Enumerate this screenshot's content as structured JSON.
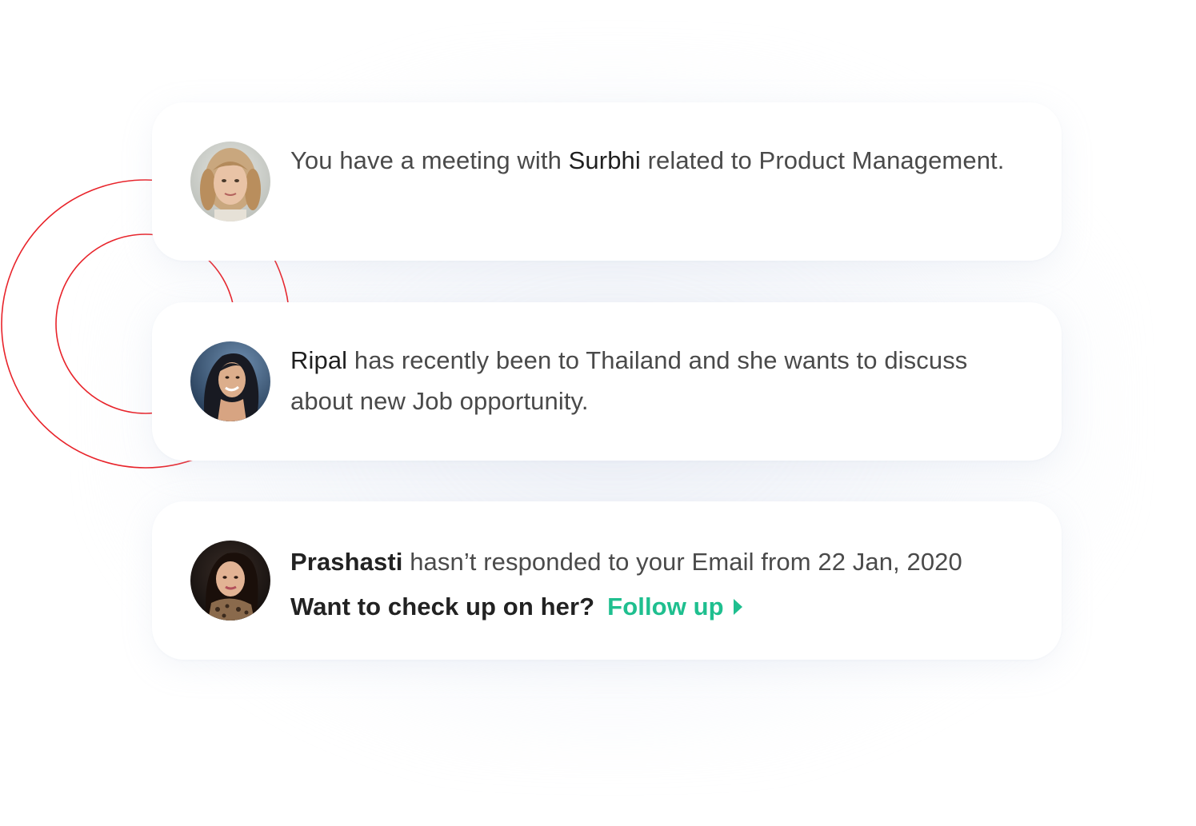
{
  "notifications": [
    {
      "prefix": "You have a meeting with ",
      "name": "Surbhi",
      "suffix": " related to Product Management.",
      "avatar_icon": "person-photo-avatar"
    },
    {
      "prefix": "",
      "name": "Ripal",
      "suffix": " has recently been to Thailand and she wants to discuss about new Job opportunity.",
      "avatar_icon": "person-photo-avatar"
    },
    {
      "prefix": "",
      "name": "Prashasti",
      "suffix": " hasn’t responded to your Email from 22 Jan, 2020",
      "question": "Want to check up on her?",
      "action_label": "Follow up",
      "action_icon": "caret-right-icon",
      "avatar_icon": "person-photo-avatar"
    }
  ],
  "colors": {
    "accent": "#1fbf8f",
    "ring": "#e8232a",
    "text": "#4a4a4a",
    "name": "#1f1f1f"
  }
}
